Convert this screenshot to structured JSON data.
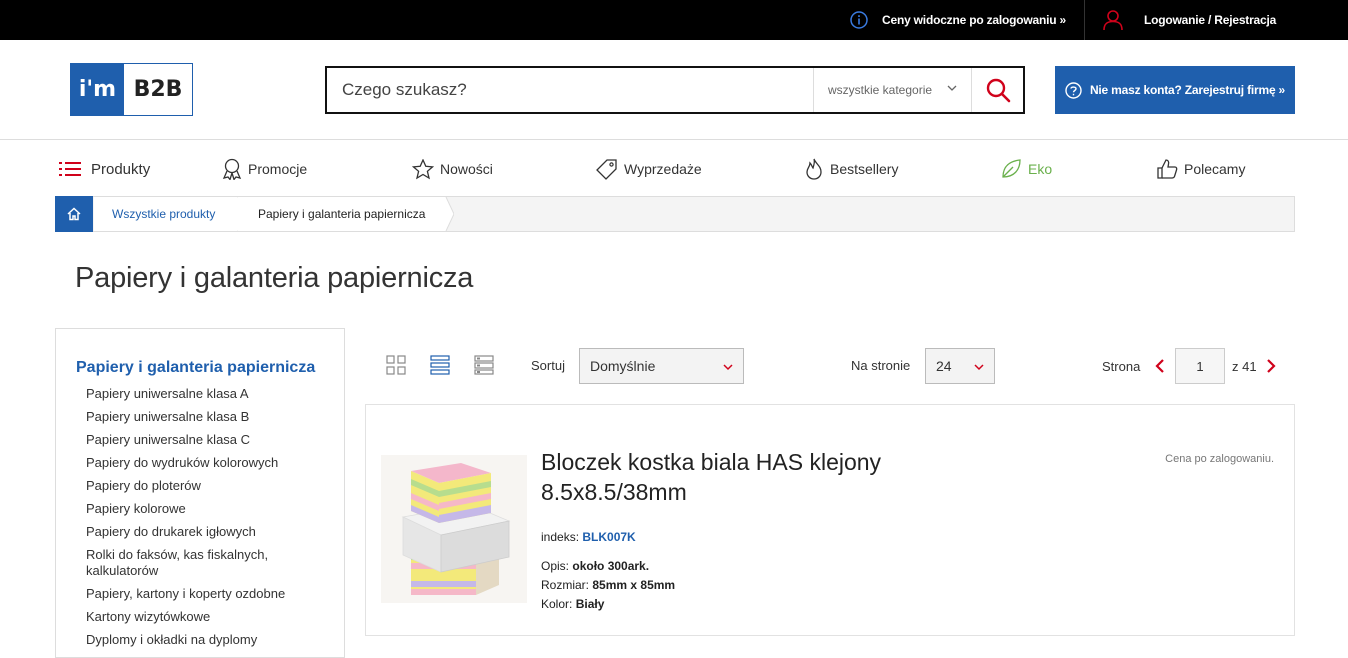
{
  "topbar": {
    "prices_note": "Ceny widoczne po zalogowaniu »",
    "login_link": "Logowanie / Rejestracja"
  },
  "header": {
    "logo_left": "i'm",
    "logo_right": "B2B",
    "search_placeholder": "Czego szukasz?",
    "category_select": "wszystkie kategorie",
    "register_button": "Nie masz konta? Zarejestruj firmę »"
  },
  "nav": {
    "produkty": "Produkty",
    "promocje": "Promocje",
    "nowosci": "Nowości",
    "wyprzedaze": "Wyprzedaże",
    "bestsellery": "Bestsellery",
    "eko": "Eko",
    "polecamy": "Polecamy"
  },
  "breadcrumb": {
    "all_products": "Wszystkie produkty",
    "current": "Papiery i galanteria papiernicza"
  },
  "page_title": "Papiery i galanteria papiernicza",
  "sidebar": {
    "heading": "Papiery i galanteria papiernicza",
    "items": [
      "Papiery uniwersalne klasa A",
      "Papiery uniwersalne klasa B",
      "Papiery uniwersalne klasa C",
      "Papiery do wydruków kolorowych",
      "Papiery do ploterów",
      "Papiery kolorowe",
      "Papiery do drukarek igłowych",
      "Rolki do faksów, kas fiskalnych, kalkulatorów",
      "Papiery, kartony i koperty ozdobne",
      "Kartony wizytówkowe",
      "Dyplomy i okładki na dyplomy"
    ]
  },
  "toolbar": {
    "sort_label": "Sortuj",
    "sort_value": "Domyślnie",
    "per_page_label": "Na stronie",
    "per_page_value": "24",
    "page_label": "Strona",
    "page_value": "1",
    "of_label": "z 41"
  },
  "product": {
    "title": "Bloczek kostka biala HAS klejony 8.5x8.5/38mm",
    "price_note": "Cena po zalogowaniu.",
    "index_label": "indeks:",
    "index_code": "BLK007K",
    "opis_label": "Opis:",
    "opis_value": "około 300ark.",
    "rozmiar_label": "Rozmiar:",
    "rozmiar_value": "85mm x 85mm",
    "kolor_label": "Kolor:",
    "kolor_value": "Biały"
  },
  "colors": {
    "brand_blue": "#1f5fad",
    "accent_red": "#d0021b",
    "eko_green": "#6ab04c"
  }
}
